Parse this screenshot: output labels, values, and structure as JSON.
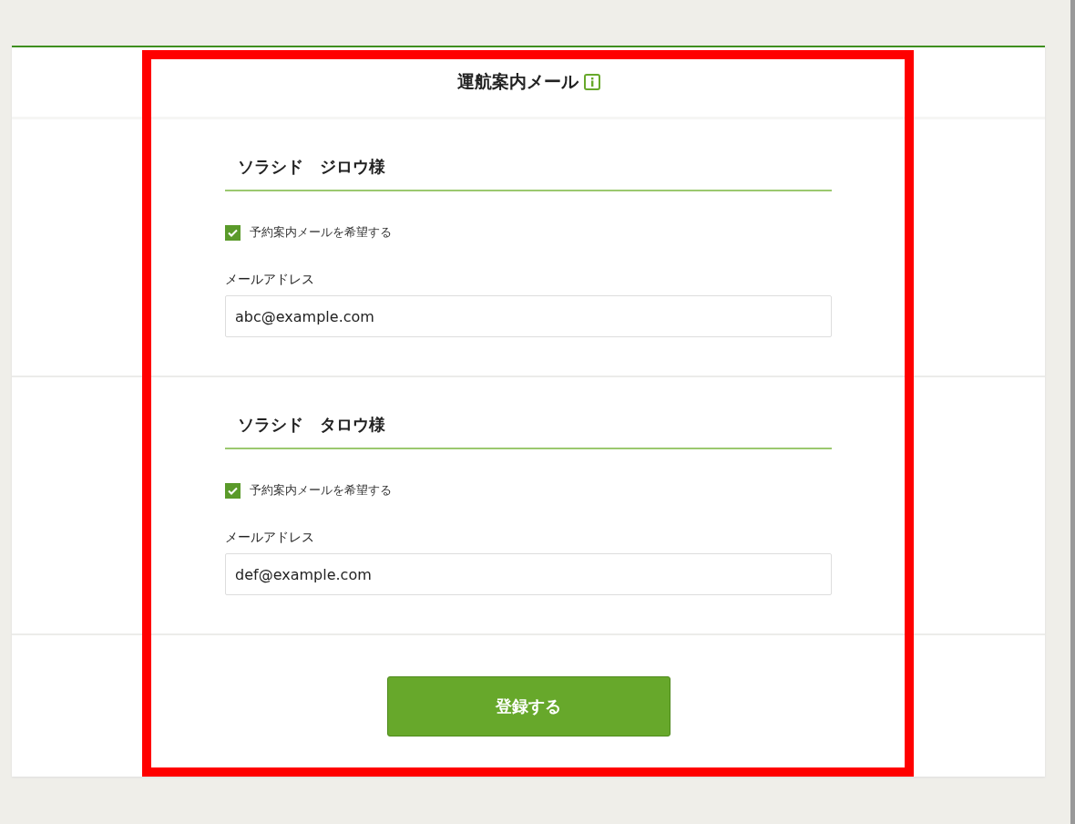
{
  "title": "運航案内メール",
  "passengers": [
    {
      "name": "ソラシド　ジロウ様",
      "opt_in": {
        "label": "予約案内メールを希望する",
        "checked": true
      },
      "email": {
        "label": "メールアドレス",
        "value": "abc@example.com"
      }
    },
    {
      "name": "ソラシド　タロウ様",
      "opt_in": {
        "label": "予約案内メールを希望する",
        "checked": true
      },
      "email": {
        "label": "メールアドレス",
        "value": "def@example.com"
      }
    }
  ],
  "submit_button": "登録する"
}
